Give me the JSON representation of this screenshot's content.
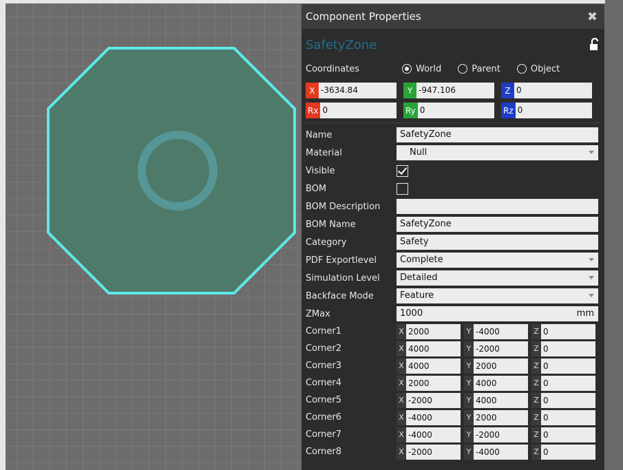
{
  "panel": {
    "title": "Component Properties",
    "close_icon": "close-icon",
    "component_name": "SafetyZone",
    "lock_icon": "unlock-icon"
  },
  "coordinates": {
    "label": "Coordinates",
    "options": [
      "World",
      "Parent",
      "Object"
    ],
    "selected": "World"
  },
  "position": {
    "x_label": "X",
    "x": "-3634.84",
    "y_label": "Y",
    "y": "-947.106",
    "z_label": "Z",
    "z": "0"
  },
  "rotation": {
    "rx_label": "Rx",
    "rx": "0",
    "ry_label": "Ry",
    "ry": "0",
    "rz_label": "Rz",
    "rz": "0"
  },
  "properties": {
    "name_label": "Name",
    "name": "SafetyZone",
    "material_label": "Material",
    "material": "Null",
    "visible_label": "Visible",
    "visible": true,
    "bom_label": "BOM",
    "bom": false,
    "bom_description_label": "BOM Description",
    "bom_description": "",
    "bom_name_label": "BOM Name",
    "bom_name": "SafetyZone",
    "category_label": "Category",
    "category": "Safety",
    "pdf_exportlevel_label": "PDF Exportlevel",
    "pdf_exportlevel": "Complete",
    "simulation_level_label": "Simulation Level",
    "simulation_level": "Detailed",
    "backface_mode_label": "Backface Mode",
    "backface_mode": "Feature",
    "zmax_label": "ZMax",
    "zmax": "1000",
    "zmax_unit": "mm"
  },
  "corners": [
    {
      "label": "Corner1",
      "x": "2000",
      "y": "-4000",
      "z": "0"
    },
    {
      "label": "Corner2",
      "x": "4000",
      "y": "-2000",
      "z": "0"
    },
    {
      "label": "Corner3",
      "x": "4000",
      "y": "2000",
      "z": "0"
    },
    {
      "label": "Corner4",
      "x": "2000",
      "y": "4000",
      "z": "0"
    },
    {
      "label": "Corner5",
      "x": "-2000",
      "y": "4000",
      "z": "0"
    },
    {
      "label": "Corner6",
      "x": "-4000",
      "y": "2000",
      "z": "0"
    },
    {
      "label": "Corner7",
      "x": "-4000",
      "y": "-2000",
      "z": "0"
    },
    {
      "label": "Corner8",
      "x": "-2000",
      "y": "-4000",
      "z": "0"
    }
  ],
  "corner_axis_labels": {
    "x": "X",
    "y": "Y",
    "z": "Z"
  },
  "colors": {
    "zone_fill": "#4e7a6a",
    "zone_outline": "#5ee8e8",
    "x_axis": "#e3391f",
    "y_axis": "#28a338",
    "z_axis": "#1f3dc4"
  }
}
